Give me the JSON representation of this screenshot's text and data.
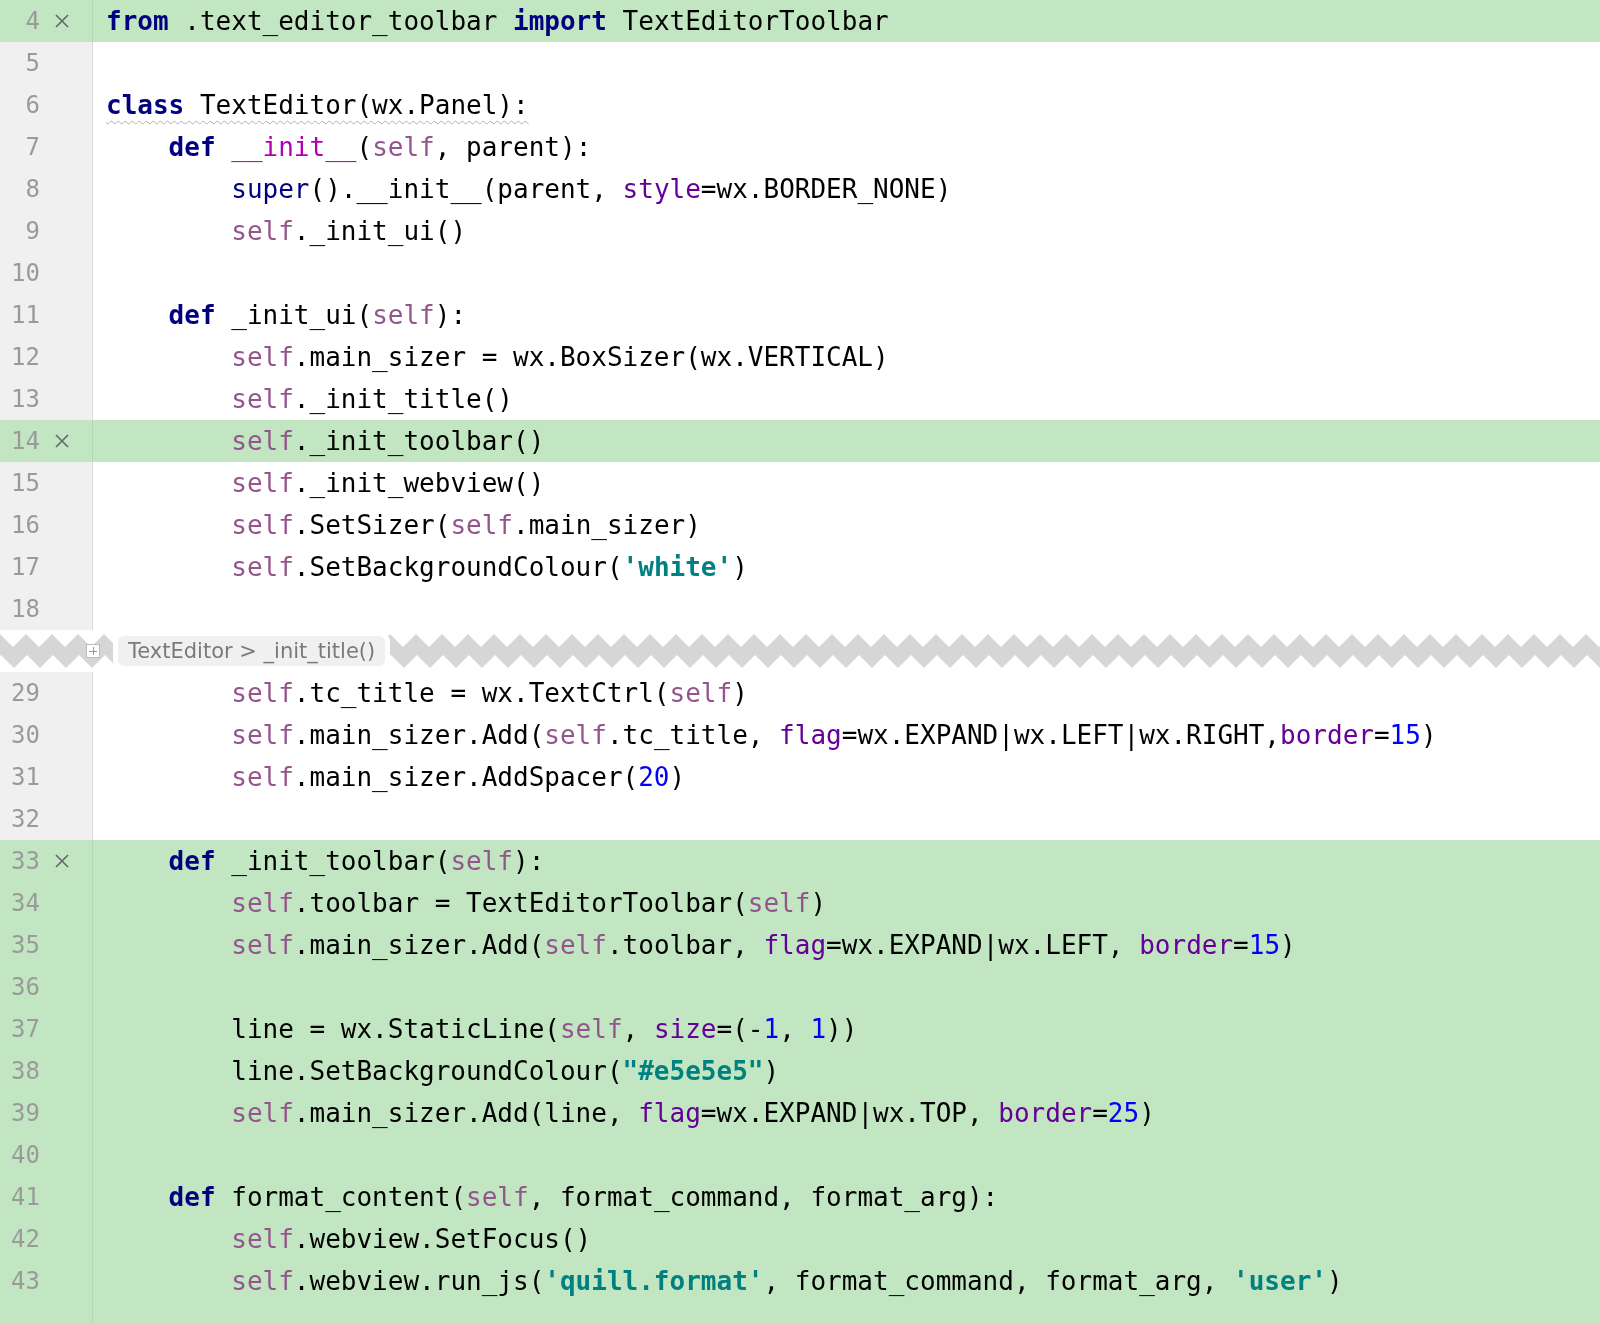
{
  "editor": {
    "lines": [
      {
        "kind": "code",
        "number": "4",
        "changed": true,
        "revert": true,
        "warning": false,
        "code": [
          {
            "kind": "keyword",
            "text": "from"
          },
          {
            "kind": "plain",
            "text": " .text_editor_toolbar "
          },
          {
            "kind": "keyword",
            "text": "import"
          },
          {
            "kind": "plain",
            "text": " TextEditorToolbar"
          }
        ]
      },
      {
        "kind": "code",
        "number": "5",
        "changed": false,
        "revert": false,
        "warning": false
      },
      {
        "kind": "code",
        "number": "6",
        "changed": false,
        "revert": false,
        "warning": true,
        "code": [
          {
            "kind": "keyword",
            "text": "class"
          },
          {
            "kind": "plain",
            "text": " TextEditor(wx.Panel):"
          }
        ]
      },
      {
        "kind": "code",
        "number": "7",
        "changed": false,
        "revert": false,
        "warning": false,
        "code": [
          {
            "kind": "keyword",
            "text": "    def "
          },
          {
            "kind": "magic",
            "text": "__init__"
          },
          {
            "kind": "plain",
            "text": "("
          },
          {
            "kind": "self",
            "text": "self"
          },
          {
            "kind": "plain",
            "text": ", parent):"
          }
        ]
      },
      {
        "kind": "code",
        "number": "8",
        "changed": false,
        "revert": false,
        "warning": false,
        "code": [
          {
            "kind": "builtin",
            "text": "        super"
          },
          {
            "kind": "plain",
            "text": "().__init__(parent, "
          },
          {
            "kind": "kwarg",
            "text": "style"
          },
          {
            "kind": "plain",
            "text": "=wx.BORDER_NONE)"
          }
        ]
      },
      {
        "kind": "code",
        "number": "9",
        "changed": false,
        "revert": false,
        "warning": false,
        "code": [
          {
            "kind": "self",
            "text": "        self"
          },
          {
            "kind": "plain",
            "text": "._init_ui()"
          }
        ]
      },
      {
        "kind": "code",
        "number": "10",
        "changed": false,
        "revert": false,
        "warning": false
      },
      {
        "kind": "code",
        "number": "11",
        "changed": false,
        "revert": false,
        "warning": false,
        "code": [
          {
            "kind": "keyword",
            "text": "    def"
          },
          {
            "kind": "plain",
            "text": " _init_ui("
          },
          {
            "kind": "self",
            "text": "self"
          },
          {
            "kind": "plain",
            "text": "):"
          }
        ]
      },
      {
        "kind": "code",
        "number": "12",
        "changed": false,
        "revert": false,
        "warning": false,
        "code": [
          {
            "kind": "self",
            "text": "        self"
          },
          {
            "kind": "plain",
            "text": ".main_sizer = wx.BoxSizer(wx.VERTICAL)"
          }
        ]
      },
      {
        "kind": "code",
        "number": "13",
        "changed": false,
        "revert": false,
        "warning": false,
        "code": [
          {
            "kind": "self",
            "text": "        self"
          },
          {
            "kind": "plain",
            "text": "._init_title()"
          }
        ]
      },
      {
        "kind": "code",
        "number": "14",
        "changed": true,
        "revert": true,
        "warning": false,
        "code": [
          {
            "kind": "self",
            "text": "        self"
          },
          {
            "kind": "plain",
            "text": "._init_toolbar()"
          }
        ]
      },
      {
        "kind": "code",
        "number": "15",
        "changed": false,
        "revert": false,
        "warning": false,
        "code": [
          {
            "kind": "self",
            "text": "        self"
          },
          {
            "kind": "plain",
            "text": "._init_webview()"
          }
        ]
      },
      {
        "kind": "code",
        "number": "16",
        "changed": false,
        "revert": false,
        "warning": false,
        "code": [
          {
            "kind": "self",
            "text": "        self"
          },
          {
            "kind": "plain",
            "text": ".SetSizer("
          },
          {
            "kind": "self",
            "text": "self"
          },
          {
            "kind": "plain",
            "text": ".main_sizer)"
          }
        ]
      },
      {
        "kind": "code",
        "number": "17",
        "changed": false,
        "revert": false,
        "warning": false,
        "code": [
          {
            "kind": "self",
            "text": "        self"
          },
          {
            "kind": "plain",
            "text": ".SetBackgroundColour("
          },
          {
            "kind": "string",
            "text": "'white'"
          },
          {
            "kind": "plain",
            "text": ")"
          }
        ]
      },
      {
        "kind": "code",
        "number": "18",
        "changed": false,
        "revert": false,
        "warning": false
      },
      {
        "kind": "fold",
        "label": "TextEditor > _init_title()"
      },
      {
        "kind": "code",
        "number": "29",
        "changed": false,
        "revert": false,
        "warning": false,
        "code": [
          {
            "kind": "self",
            "text": "        self"
          },
          {
            "kind": "plain",
            "text": ".tc_title = wx.TextCtrl("
          },
          {
            "kind": "self",
            "text": "self"
          },
          {
            "kind": "plain",
            "text": ")"
          }
        ]
      },
      {
        "kind": "code",
        "number": "30",
        "changed": false,
        "revert": false,
        "warning": false,
        "code": [
          {
            "kind": "self",
            "text": "        self"
          },
          {
            "kind": "plain",
            "text": ".main_sizer.Add("
          },
          {
            "kind": "self",
            "text": "self"
          },
          {
            "kind": "plain",
            "text": ".tc_title, "
          },
          {
            "kind": "kwarg",
            "text": "flag"
          },
          {
            "kind": "plain",
            "text": "=wx.EXPAND|wx.LEFT|wx.RIGHT,"
          },
          {
            "kind": "kwarg",
            "text": "border"
          },
          {
            "kind": "plain",
            "text": "="
          },
          {
            "kind": "number",
            "text": "15"
          },
          {
            "kind": "plain",
            "text": ")"
          }
        ]
      },
      {
        "kind": "code",
        "number": "31",
        "changed": false,
        "revert": false,
        "warning": false,
        "code": [
          {
            "kind": "self",
            "text": "        self"
          },
          {
            "kind": "plain",
            "text": ".main_sizer.AddSpacer("
          },
          {
            "kind": "number",
            "text": "20"
          },
          {
            "kind": "plain",
            "text": ")"
          }
        ]
      },
      {
        "kind": "code",
        "number": "32",
        "changed": false,
        "revert": false,
        "warning": false
      },
      {
        "kind": "code",
        "number": "33",
        "changed": true,
        "revert": true,
        "warning": false,
        "code": [
          {
            "kind": "keyword",
            "text": "    def"
          },
          {
            "kind": "plain",
            "text": " _init_toolbar("
          },
          {
            "kind": "self",
            "text": "self"
          },
          {
            "kind": "plain",
            "text": "):"
          }
        ]
      },
      {
        "kind": "code",
        "number": "34",
        "changed": true,
        "revert": false,
        "warning": false,
        "code": [
          {
            "kind": "self",
            "text": "        self"
          },
          {
            "kind": "plain",
            "text": ".toolbar = TextEditorToolbar("
          },
          {
            "kind": "self",
            "text": "self"
          },
          {
            "kind": "plain",
            "text": ")"
          }
        ]
      },
      {
        "kind": "code",
        "number": "35",
        "changed": true,
        "revert": false,
        "warning": false,
        "code": [
          {
            "kind": "self",
            "text": "        self"
          },
          {
            "kind": "plain",
            "text": ".main_sizer.Add("
          },
          {
            "kind": "self",
            "text": "self"
          },
          {
            "kind": "plain",
            "text": ".toolbar, "
          },
          {
            "kind": "kwarg",
            "text": "flag"
          },
          {
            "kind": "plain",
            "text": "=wx.EXPAND|wx.LEFT, "
          },
          {
            "kind": "kwarg",
            "text": "border"
          },
          {
            "kind": "plain",
            "text": "="
          },
          {
            "kind": "number",
            "text": "15"
          },
          {
            "kind": "plain",
            "text": ")"
          }
        ]
      },
      {
        "kind": "code",
        "number": "36",
        "changed": true,
        "revert": false,
        "warning": false
      },
      {
        "kind": "code",
        "number": "37",
        "changed": true,
        "revert": false,
        "warning": false,
        "code": [
          {
            "kind": "plain",
            "text": "        line = wx.StaticLine("
          },
          {
            "kind": "self",
            "text": "self"
          },
          {
            "kind": "plain",
            "text": ", "
          },
          {
            "kind": "kwarg",
            "text": "size"
          },
          {
            "kind": "plain",
            "text": "=(-"
          },
          {
            "kind": "number",
            "text": "1"
          },
          {
            "kind": "plain",
            "text": ", "
          },
          {
            "kind": "number",
            "text": "1"
          },
          {
            "kind": "plain",
            "text": "))"
          }
        ]
      },
      {
        "kind": "code",
        "number": "38",
        "changed": true,
        "revert": false,
        "warning": false,
        "code": [
          {
            "kind": "plain",
            "text": "        line.SetBackgroundColour("
          },
          {
            "kind": "string",
            "text": "\"#e5e5e5\""
          },
          {
            "kind": "plain",
            "text": ")"
          }
        ]
      },
      {
        "kind": "code",
        "number": "39",
        "changed": true,
        "revert": false,
        "warning": false,
        "code": [
          {
            "kind": "self",
            "text": "        self"
          },
          {
            "kind": "plain",
            "text": ".main_sizer.Add(line, "
          },
          {
            "kind": "kwarg",
            "text": "flag"
          },
          {
            "kind": "plain",
            "text": "=wx.EXPAND|wx.TOP, "
          },
          {
            "kind": "kwarg",
            "text": "border"
          },
          {
            "kind": "plain",
            "text": "="
          },
          {
            "kind": "number",
            "text": "25"
          },
          {
            "kind": "plain",
            "text": ")"
          }
        ]
      },
      {
        "kind": "code",
        "number": "40",
        "changed": true,
        "revert": false,
        "warning": false
      },
      {
        "kind": "code",
        "number": "41",
        "changed": true,
        "revert": false,
        "warning": false,
        "code": [
          {
            "kind": "keyword",
            "text": "    def"
          },
          {
            "kind": "plain",
            "text": " format_content("
          },
          {
            "kind": "self",
            "text": "self"
          },
          {
            "kind": "plain",
            "text": ", format_command, format_arg):"
          }
        ]
      },
      {
        "kind": "code",
        "number": "42",
        "changed": true,
        "revert": false,
        "warning": false,
        "code": [
          {
            "kind": "self",
            "text": "        self"
          },
          {
            "kind": "plain",
            "text": ".webview.SetFocus()"
          }
        ]
      },
      {
        "kind": "code",
        "number": "43",
        "changed": true,
        "revert": false,
        "warning": false,
        "code": [
          {
            "kind": "self",
            "text": "        self"
          },
          {
            "kind": "plain",
            "text": ".webview.run_js("
          },
          {
            "kind": "string",
            "text": "'quill.format'"
          },
          {
            "kind": "plain",
            "text": ", format_command, format_arg, "
          },
          {
            "kind": "string",
            "text": "'user'"
          },
          {
            "kind": "plain",
            "text": ")"
          }
        ]
      },
      {
        "kind": "code",
        "changed": true,
        "revert": false,
        "warning": false
      }
    ]
  }
}
